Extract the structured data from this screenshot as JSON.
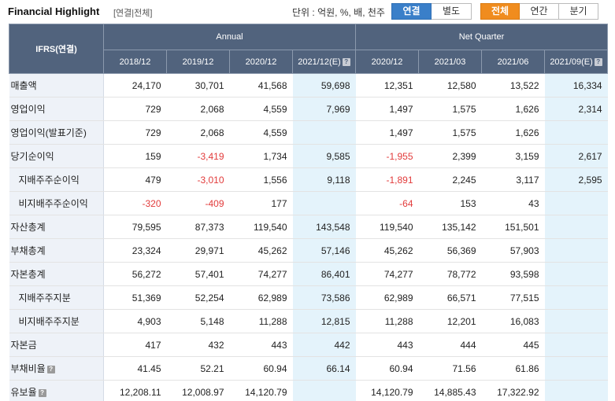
{
  "header": {
    "title": "Financial Highlight",
    "scope": "[연결|전체]",
    "unit": "단위 : 억원, %, 배, 천주"
  },
  "toggles": {
    "consolidation": [
      {
        "label": "연결",
        "active": true
      },
      {
        "label": "별도",
        "active": false
      }
    ],
    "period": [
      {
        "label": "전체",
        "active": true
      },
      {
        "label": "연간",
        "active": false
      },
      {
        "label": "분기",
        "active": false
      }
    ]
  },
  "table": {
    "corner_label": "IFRS(연결)",
    "group_annual": "Annual",
    "group_quarter": "Net Quarter",
    "columns": [
      "2018/12",
      "2019/12",
      "2020/12",
      "2021/12(E)",
      "2020/12",
      "2021/03",
      "2021/06",
      "2021/09(E)"
    ],
    "rows": [
      {
        "label": "매출액",
        "icon": false,
        "values": [
          "24,170",
          "30,701",
          "41,568",
          "59,698",
          "12,351",
          "12,580",
          "13,522",
          "16,334"
        ]
      },
      {
        "label": "영업이익",
        "icon": false,
        "values": [
          "729",
          "2,068",
          "4,559",
          "7,969",
          "1,497",
          "1,575",
          "1,626",
          "2,314"
        ]
      },
      {
        "label": "영업이익(발표기준)",
        "icon": false,
        "values": [
          "729",
          "2,068",
          "4,559",
          "",
          "1,497",
          "1,575",
          "1,626",
          ""
        ]
      },
      {
        "label": "당기순이익",
        "icon": false,
        "values": [
          "159",
          "-3,419",
          "1,734",
          "9,585",
          "-1,955",
          "2,399",
          "3,159",
          "2,617"
        ]
      },
      {
        "label": "지배주주순이익",
        "icon": false,
        "values": [
          "479",
          "-3,010",
          "1,556",
          "9,118",
          "-1,891",
          "2,245",
          "3,117",
          "2,595"
        ]
      },
      {
        "label": "비지배주주순이익",
        "icon": false,
        "values": [
          "-320",
          "-409",
          "177",
          "",
          "-64",
          "153",
          "43",
          ""
        ]
      },
      {
        "label": "자산총계",
        "icon": false,
        "values": [
          "79,595",
          "87,373",
          "119,540",
          "143,548",
          "119,540",
          "135,142",
          "151,501",
          ""
        ]
      },
      {
        "label": "부채총계",
        "icon": false,
        "values": [
          "23,324",
          "29,971",
          "45,262",
          "57,146",
          "45,262",
          "56,369",
          "57,903",
          ""
        ]
      },
      {
        "label": "자본총계",
        "icon": false,
        "values": [
          "56,272",
          "57,401",
          "74,277",
          "86,401",
          "74,277",
          "78,772",
          "93,598",
          ""
        ]
      },
      {
        "label": "지배주주지분",
        "icon": false,
        "values": [
          "51,369",
          "52,254",
          "62,989",
          "73,586",
          "62,989",
          "66,571",
          "77,515",
          ""
        ]
      },
      {
        "label": "비지배주주지분",
        "icon": false,
        "values": [
          "4,903",
          "5,148",
          "11,288",
          "12,815",
          "11,288",
          "12,201",
          "16,083",
          ""
        ]
      },
      {
        "label": "자본금",
        "icon": false,
        "values": [
          "417",
          "432",
          "443",
          "442",
          "443",
          "444",
          "445",
          ""
        ]
      },
      {
        "label": "부채비율",
        "icon": true,
        "values": [
          "41.45",
          "52.21",
          "60.94",
          "66.14",
          "60.94",
          "71.56",
          "61.86",
          ""
        ]
      },
      {
        "label": "유보율",
        "icon": true,
        "values": [
          "12,208.11",
          "12,008.97",
          "14,120.79",
          "",
          "14,120.79",
          "14,885.43",
          "17,322.92",
          ""
        ]
      }
    ],
    "help_icon_glyph": "?"
  },
  "colors": {
    "header_bg": "#51637d",
    "label_bg": "#eef2f8",
    "estimate_bg": "#e4f3fb",
    "negative": "#e23b3b",
    "blue_toggle": "#3a7fc9",
    "orange_toggle": "#f08c1e"
  }
}
